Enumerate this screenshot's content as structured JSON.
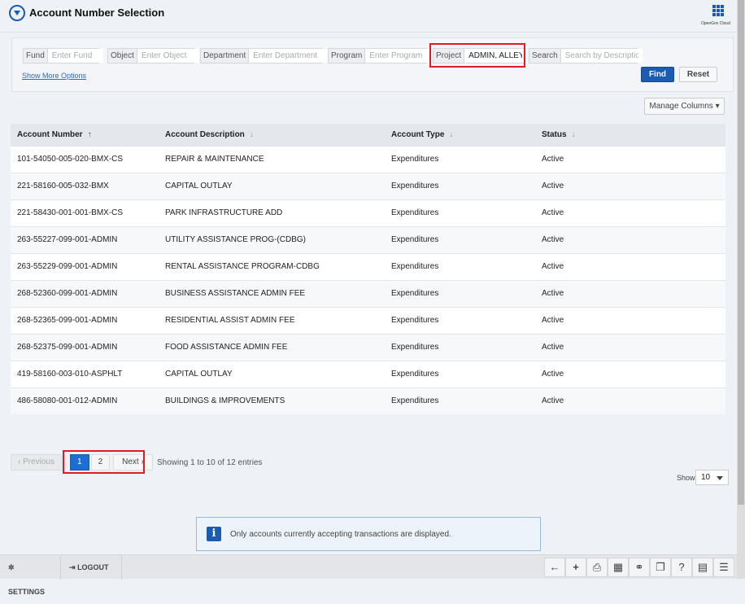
{
  "header": {
    "title": "Account Number Selection",
    "brand": "OpenGov Cloud"
  },
  "filters": [
    {
      "label": "Fund",
      "placeholder": "Enter Fund",
      "value": ""
    },
    {
      "label": "Object",
      "placeholder": "Enter Object",
      "value": ""
    },
    {
      "label": "Department",
      "placeholder": "Enter Department",
      "value": ""
    },
    {
      "label": "Program",
      "placeholder": "Enter Program",
      "value": ""
    },
    {
      "label": "Project",
      "placeholder": "",
      "value": "ADMIN, ALLEY, A"
    },
    {
      "label": "Search",
      "placeholder": "Search by Description",
      "value": ""
    }
  ],
  "show_more": "Show More Options",
  "find": "Find",
  "reset": "Reset",
  "manage_columns": "Manage Columns",
  "table": {
    "headers": [
      "Account Number",
      "Account Description",
      "Account Type",
      "Status"
    ],
    "rows": [
      [
        "101-54050-005-020-BMX-CS",
        "REPAIR & MAINTENANCE",
        "Expenditures",
        "Active"
      ],
      [
        "221-58160-005-032-BMX",
        "CAPITAL OUTLAY",
        "Expenditures",
        "Active"
      ],
      [
        "221-58430-001-001-BMX-CS",
        "PARK INFRASTRUCTURE ADD",
        "Expenditures",
        "Active"
      ],
      [
        "263-55227-099-001-ADMIN",
        "UTILITY ASSISTANCE PROG-(CDBG)",
        "Expenditures",
        "Active"
      ],
      [
        "263-55229-099-001-ADMIN",
        "RENTAL ASSISTANCE PROGRAM-CDBG",
        "Expenditures",
        "Active"
      ],
      [
        "268-52360-099-001-ADMIN",
        "BUSINESS ASSISTANCE ADMIN FEE",
        "Expenditures",
        "Active"
      ],
      [
        "268-52365-099-001-ADMIN",
        "RESIDENTIAL ASSIST ADMIN FEE",
        "Expenditures",
        "Active"
      ],
      [
        "268-52375-099-001-ADMIN",
        "FOOD ASSISTANCE ADMIN FEE",
        "Expenditures",
        "Active"
      ],
      [
        "419-58160-003-010-ASPHLT",
        "CAPITAL OUTLAY",
        "Expenditures",
        "Active"
      ],
      [
        "486-58080-001-012-ADMIN",
        "BUILDINGS & IMPROVEMENTS",
        "Expenditures",
        "Active"
      ]
    ]
  },
  "pagination": {
    "previous": "‹ Previous",
    "pages": [
      "1",
      "2"
    ],
    "current": "1",
    "next": "Next ›",
    "summary": "Showing 1 to 10 of 12 entries",
    "show_label": "Show",
    "page_size": "10"
  },
  "info": "Only accounts currently accepting transactions are displayed.",
  "footer": {
    "settings": "SETTINGS",
    "logout": "LOGOUT",
    "tools": [
      "back-icon",
      "add-icon",
      "print-icon",
      "calculator-icon",
      "binoculars-icon",
      "windows-icon",
      "help-icon",
      "calendar-icon",
      "tree-icon"
    ]
  },
  "colors": {
    "accent": "#1c5cb0",
    "highlight": "#e01b24"
  }
}
